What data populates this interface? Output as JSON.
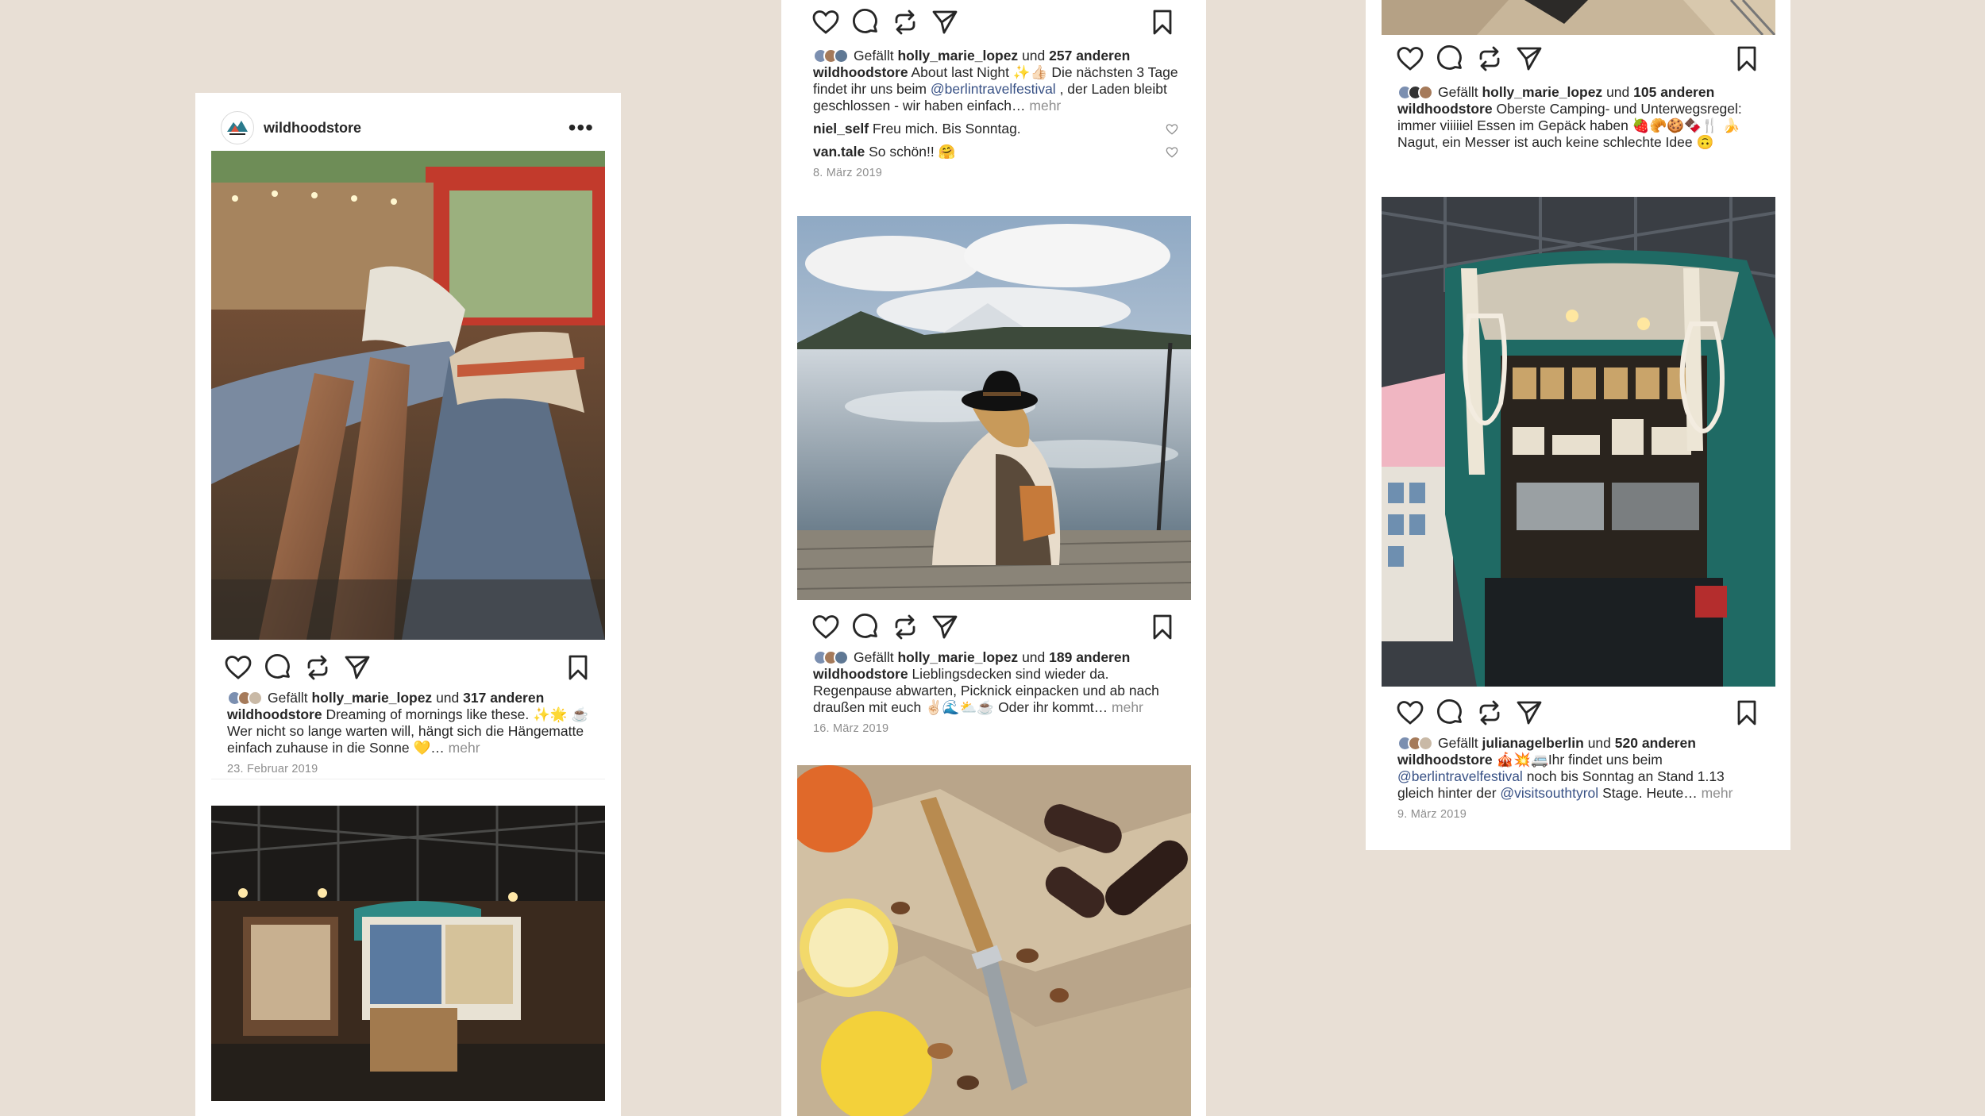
{
  "colors": {
    "background": "#e8dfd5",
    "card": "#ffffff",
    "text": "#262626",
    "link": "#385185",
    "muted": "#8e8e8e"
  },
  "icons": {
    "like": "heart-icon",
    "comment": "comment-icon",
    "share": "repost-icon",
    "send": "send-icon",
    "save": "bookmark-icon",
    "more": "more-dots-icon"
  },
  "col1": {
    "header": {
      "username": "wildhoodstore",
      "more": "•••"
    },
    "post1": {
      "likes_prefix": "Gefällt",
      "liker": "holly_marie_lopez",
      "likes_mid": "und",
      "likes_count": "317 anderen",
      "author": "wildhoodstore",
      "caption": "Dreaming of mornings like these. ✨🌟 ☕ Wer nicht so lange warten will, hängt sich die Hängematte einfach zuhause in die Sonne 💛…",
      "more": "mehr",
      "date": "23. Februar 2019"
    }
  },
  "col2": {
    "post1": {
      "likes_prefix": "Gefällt",
      "liker": "holly_marie_lopez",
      "likes_mid": "und",
      "likes_count": "257 anderen",
      "author": "wildhoodstore",
      "caption_a": "About last Night ✨👍🏻 Die nächsten 3 Tage findet ihr uns beim",
      "mention": "@berlintravelfestival",
      "caption_b": ", der Laden bleibt geschlossen - wir haben einfach…",
      "more": "mehr",
      "comments": [
        {
          "user": "niel_self",
          "text": "Freu mich. Bis Sonntag."
        },
        {
          "user": "van.tale",
          "text": "So schön!! 🤗"
        }
      ],
      "date": "8. März 2019"
    },
    "post2": {
      "likes_prefix": "Gefällt",
      "liker": "holly_marie_lopez",
      "likes_mid": "und",
      "likes_count": "189 anderen",
      "author": "wildhoodstore",
      "caption": "Lieblingsdecken sind wieder da. Regenpause abwarten, Picknick einpacken und ab nach draußen mit euch ✌🏻🌊⛅☕ Oder ihr kommt…",
      "more": "mehr",
      "date": "16. März 2019"
    }
  },
  "col3": {
    "post1": {
      "likes_prefix": "Gefällt",
      "liker": "holly_marie_lopez",
      "likes_mid": "und",
      "likes_count": "105 anderen",
      "author": "wildhoodstore",
      "caption": "Oberste Camping- und Unterwegsregel: immer viiiiiel Essen im Gepäck haben 🍓🥐🍪🍫🍴 🍌 Nagut, ein Messer ist auch keine schlechte Idee 🙃"
    },
    "post2": {
      "likes_prefix": "Gefällt",
      "liker": "julianagelberlin",
      "likes_mid": "und",
      "likes_count": "520 anderen",
      "author": "wildhoodstore",
      "caption_a": "🎪💥🚐Ihr findet uns beim",
      "mention1": "@berlintravelfestival",
      "caption_b": "noch bis Sonntag an Stand 1.13 gleich hinter der",
      "mention2": "@visitsouthtyrol",
      "caption_c": "Stage. Heute…",
      "more": "mehr",
      "date": "9. März 2019"
    }
  }
}
